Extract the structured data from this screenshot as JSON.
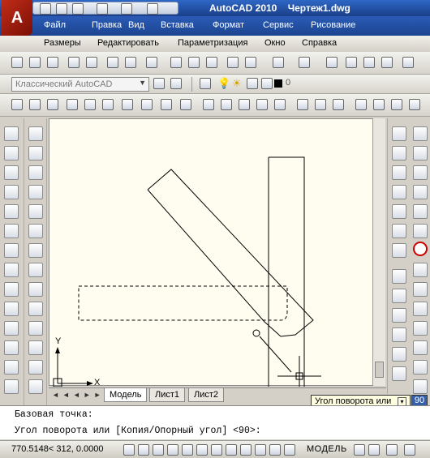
{
  "app": {
    "title": "AutoCAD 2010",
    "document": "Чертеж1.dwg"
  },
  "menu": [
    "Файл",
    "Правка",
    "Вид",
    "Вставка",
    "Формат",
    "Сервис",
    "Рисование",
    "Размеры",
    "Редактировать",
    "Параметризация",
    "Окно",
    "Справка"
  ],
  "workspace": {
    "selected": "Классический AutoCAD"
  },
  "layer": {
    "name": "0"
  },
  "tabs": {
    "model": "Модель",
    "sheet1": "Лист1",
    "sheet2": "Лист2"
  },
  "axis": {
    "x": "X",
    "y": "Y"
  },
  "command": {
    "line1": "Базовая точка:",
    "line2": "Угол поворота или [Копия/Опорный угол] <90>:"
  },
  "tooltip": {
    "label": "Угол поворота или",
    "value": "90"
  },
  "status": {
    "coords": "770.5148< 312, 0.0000",
    "model": "МОДЕЛЬ"
  },
  "colors": {
    "titlebar": "#1d448f",
    "canvas": "#fffcf0",
    "highlight": "#cc0000"
  }
}
